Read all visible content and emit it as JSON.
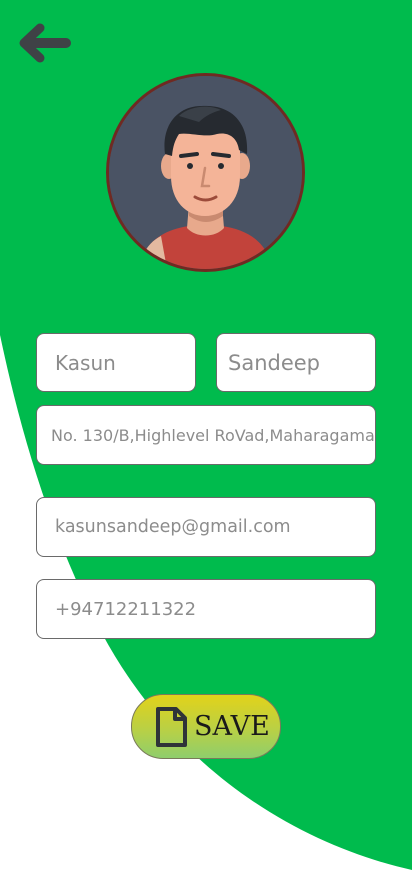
{
  "colors": {
    "background_green": "#00bb4d",
    "background_white": "#ffffff",
    "field_text": "#8c8c8c"
  },
  "header": {
    "back_icon": "arrow-left-icon"
  },
  "profile": {
    "avatar": "male-avatar-illustration"
  },
  "form": {
    "first_name": "Kasun",
    "last_name": "Sandeep",
    "address": "No. 130/B,Highlevel RoVad,Maharagama.",
    "email": "kasunsandeep@gmail.com",
    "phone": "+94712211322"
  },
  "actions": {
    "save_icon": "document-icon",
    "save_label": "SAVE"
  }
}
